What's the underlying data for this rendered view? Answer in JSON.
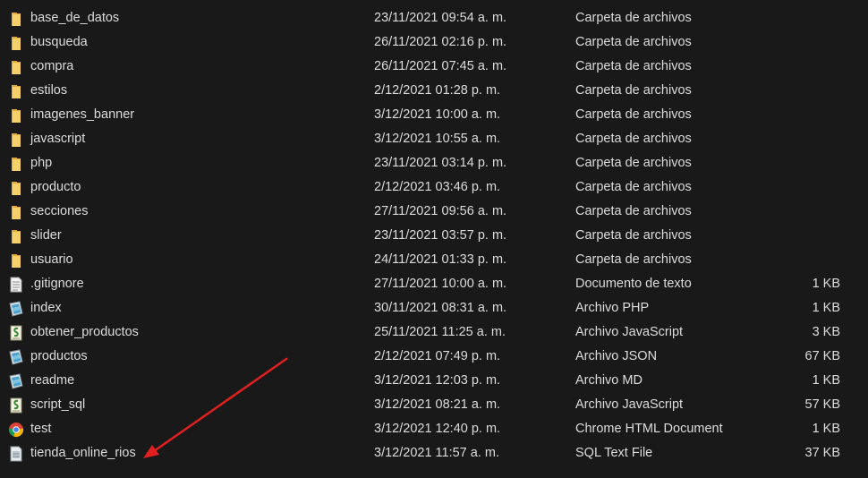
{
  "files": [
    {
      "name": "base_de_datos",
      "date": "23/11/2021 09:54 a. m.",
      "type": "Carpeta de archivos",
      "size": "",
      "icon": "folder-icon"
    },
    {
      "name": "busqueda",
      "date": "26/11/2021 02:16 p. m.",
      "type": "Carpeta de archivos",
      "size": "",
      "icon": "folder-icon"
    },
    {
      "name": "compra",
      "date": "26/11/2021 07:45 a. m.",
      "type": "Carpeta de archivos",
      "size": "",
      "icon": "folder-icon"
    },
    {
      "name": "estilos",
      "date": "2/12/2021 01:28 p. m.",
      "type": "Carpeta de archivos",
      "size": "",
      "icon": "folder-icon"
    },
    {
      "name": "imagenes_banner",
      "date": "3/12/2021 10:00 a. m.",
      "type": "Carpeta de archivos",
      "size": "",
      "icon": "folder-icon"
    },
    {
      "name": "javascript",
      "date": "3/12/2021 10:55 a. m.",
      "type": "Carpeta de archivos",
      "size": "",
      "icon": "folder-icon"
    },
    {
      "name": "php",
      "date": "23/11/2021 03:14 p. m.",
      "type": "Carpeta de archivos",
      "size": "",
      "icon": "folder-icon"
    },
    {
      "name": "producto",
      "date": "2/12/2021 03:46 p. m.",
      "type": "Carpeta de archivos",
      "size": "",
      "icon": "folder-icon"
    },
    {
      "name": "secciones",
      "date": "27/11/2021 09:56 a. m.",
      "type": "Carpeta de archivos",
      "size": "",
      "icon": "folder-icon"
    },
    {
      "name": "slider",
      "date": "23/11/2021 03:57 p. m.",
      "type": "Carpeta de archivos",
      "size": "",
      "icon": "folder-icon"
    },
    {
      "name": "usuario",
      "date": "24/11/2021 01:33 p. m.",
      "type": "Carpeta de archivos",
      "size": "",
      "icon": "folder-icon"
    },
    {
      "name": ".gitignore",
      "date": "27/11/2021 10:00 a. m.",
      "type": "Documento de texto",
      "size": "1 KB",
      "icon": "text-document-icon"
    },
    {
      "name": "index",
      "date": "30/11/2021 08:31 a. m.",
      "type": "Archivo PHP",
      "size": "1 KB",
      "icon": "generic-file-icon"
    },
    {
      "name": "obtener_productos",
      "date": "25/11/2021 11:25 a. m.",
      "type": "Archivo JavaScript",
      "size": "3 KB",
      "icon": "script-file-icon"
    },
    {
      "name": "productos",
      "date": "2/12/2021 07:49 p. m.",
      "type": "Archivo JSON",
      "size": "67 KB",
      "icon": "generic-file-icon"
    },
    {
      "name": "readme",
      "date": "3/12/2021 12:03 p. m.",
      "type": "Archivo MD",
      "size": "1 KB",
      "icon": "generic-file-icon"
    },
    {
      "name": "script_sql",
      "date": "3/12/2021 08:21 a. m.",
      "type": "Archivo JavaScript",
      "size": "57 KB",
      "icon": "script-file-icon"
    },
    {
      "name": "test",
      "date": "3/12/2021 12:40 p. m.",
      "type": "Chrome HTML Document",
      "size": "1 KB",
      "icon": "chrome-icon"
    },
    {
      "name": "tienda_online_rios",
      "date": "3/12/2021 11:57 a. m.",
      "type": "SQL Text File",
      "size": "37 KB",
      "icon": "sql-file-icon"
    }
  ],
  "colors": {
    "background": "#191919",
    "text": "#dcdcdc",
    "folder": "#f2c55c",
    "annotation_arrow": "#e02020"
  }
}
